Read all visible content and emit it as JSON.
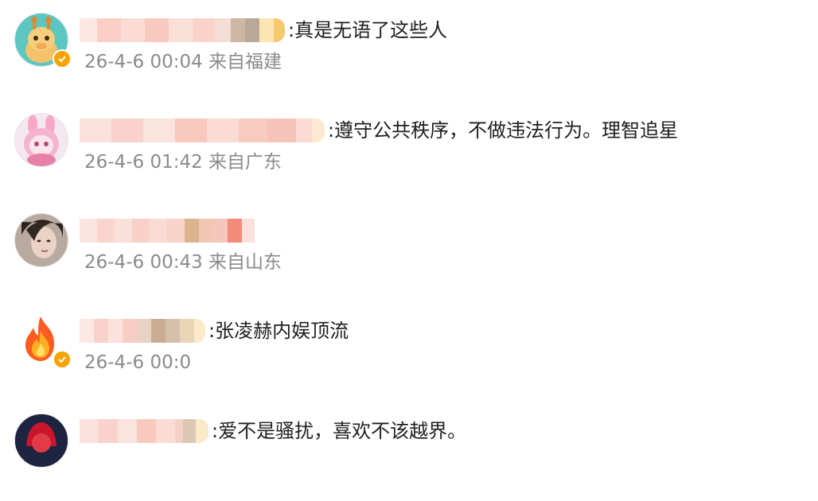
{
  "comments": [
    {
      "avatar_icon": "giraffe-avatar-icon",
      "verified": true,
      "text": ":真是无语了这些人",
      "time": "26-4-6 00:04",
      "location": "来自福建"
    },
    {
      "avatar_icon": "pink-rabbit-avatar-icon",
      "verified": false,
      "text": ":遵守公共秩序，不做违法行为。理智追星",
      "time": "26-4-6 01:42",
      "location": "来自广东"
    },
    {
      "avatar_icon": "portrait-avatar-icon",
      "verified": false,
      "text": "",
      "time": "26-4-6 00:43",
      "location": "来自山东"
    },
    {
      "avatar_icon": "fire-avatar-icon",
      "verified": true,
      "text": ":张凌赫内娱顶流",
      "time": "26-4-6 00:0",
      "location": ""
    },
    {
      "avatar_icon": "red-hood-avatar-icon",
      "verified": false,
      "text": ":爱不是骚扰，喜欢不该越界。",
      "time": "",
      "location": ""
    }
  ],
  "colors": {
    "meta_text": "#8a8a8a",
    "verified_badge": "#f5a300",
    "mosaic_pink": "#f7c8c0",
    "mosaic_light": "#fbe3de"
  }
}
